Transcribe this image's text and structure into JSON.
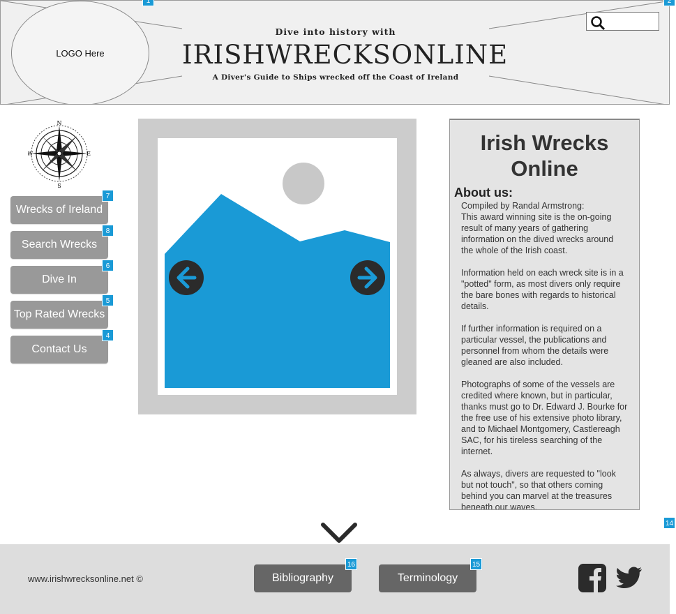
{
  "header": {
    "logo_text": "LOGO Here",
    "tagline_top": "Dive into history with",
    "site_name": "IRISHWRECKSONLINE",
    "tagline_sub": "A Diver's Guide to Ships wrecked off the Coast of Ireland",
    "search": {
      "value": "",
      "placeholder": ""
    },
    "badges": {
      "header": "1",
      "search": "2"
    }
  },
  "nav": {
    "items": [
      {
        "label": "Wrecks of Ireland",
        "badge": "7"
      },
      {
        "label": "Search Wrecks",
        "badge": "8"
      },
      {
        "label": "Dive In",
        "badge": "6"
      },
      {
        "label": "Top Rated Wrecks",
        "badge": "5"
      },
      {
        "label": "Contact Us",
        "badge": "4"
      }
    ]
  },
  "about": {
    "title_line1": "Irish Wrecks",
    "title_line2": "Online",
    "heading": "About us:",
    "credit": "Compiled by Randal Armstrong:",
    "paragraphs": [
      "This award winning site is the on-going result of many years of gathering information on the dived wrecks around the whole of the Irish coast.",
      "Information held on each wreck site is in a \"potted\" form, as most divers only require the bare bones with regards to historical details.",
      "If further information is required on a particular vessel, the publications and personnel from whom the details were gleaned are also included.",
      "Photographs of some of the vessels are credited where known, but in particular, thanks must go to Dr. Edward J. Bourke for the free use of his extensive photo library, and to Michael Montgomery, Castlereagh SAC, for his tireless searching of the internet.",
      "As always, divers are requested to \"look but not touch\", so that others coming behind you can marvel at the treasures beneath our waves."
    ]
  },
  "scroll_badge": "14",
  "footer": {
    "copyright": "www.irishwrecksonline.net ©",
    "bibliography_label": "Bibliography",
    "bibliography_badge": "16",
    "terminology_label": "Terminology",
    "terminology_badge": "15"
  },
  "icons": [
    "search-icon",
    "compass-icon",
    "image-placeholder",
    "arrow-left-icon",
    "arrow-right-icon",
    "chevron-down-icon",
    "facebook-icon",
    "twitter-icon"
  ],
  "colors": {
    "accent": "#1a9ad6",
    "nav_button": "#999999",
    "footer_button": "#666666",
    "image_blue": "#1a9ad6"
  }
}
